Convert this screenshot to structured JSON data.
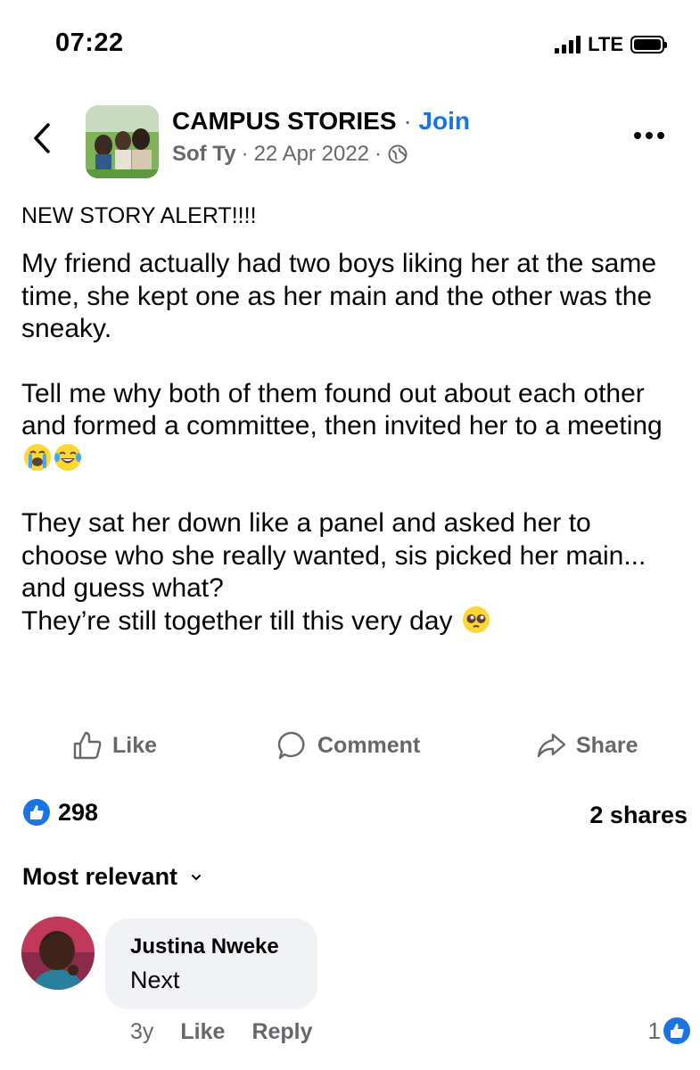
{
  "status_bar": {
    "time": "07:22",
    "network": "LTE"
  },
  "post": {
    "group_name": "CAMPUS STORIES",
    "separator": "·",
    "join_label": "Join",
    "author": "Sof Ty",
    "date": "22 Apr 2022",
    "alert": "NEW STORY ALERT!!!!",
    "paragraphs": [
      "My friend actually had two boys liking her at the same time, she kept one as her main and the other was the sneaky.",
      "Tell me why both of them found out about each other and formed a committee, then invited her to a meeting",
      "They sat her down like a panel and asked her to choose who she really wanted, sis picked her main... and guess what?",
      "They’re still together till this very day"
    ]
  },
  "actions": {
    "like": "Like",
    "comment": "Comment",
    "share": "Share"
  },
  "stats": {
    "likes": "298",
    "shares": "2 shares"
  },
  "sort_label": "Most relevant",
  "comment": {
    "name": "Justina Nweke",
    "text": "Next",
    "age": "3y",
    "like": "Like",
    "reply": "Reply",
    "likes": "1"
  },
  "colors": {
    "accent": "#1b74e4",
    "muted": "#65676b",
    "bubble": "#f0f2f5"
  }
}
